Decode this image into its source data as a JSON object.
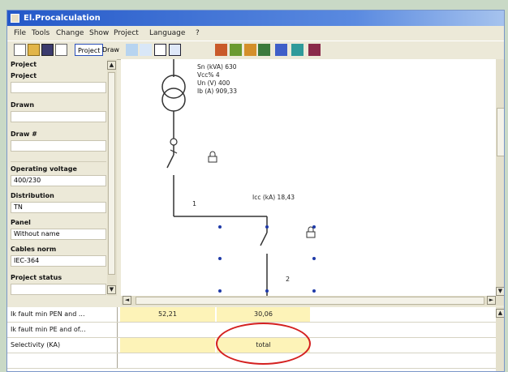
{
  "window": {
    "title": "El.Procalculation"
  },
  "menu": [
    "File",
    "Tools",
    "Change",
    "Show",
    "Project",
    "Language",
    "?"
  ],
  "toolbar": {
    "project_label": "Project",
    "draw_label": "Draw"
  },
  "project_panel": {
    "header": "Project",
    "fields": [
      {
        "label": "Project",
        "value": ""
      },
      {
        "label": "Drawn",
        "value": ""
      },
      {
        "label": "Draw #",
        "value": ""
      },
      {
        "label": "Operating voltage",
        "value": "400/230"
      },
      {
        "label": "Distribution",
        "value": "TN"
      },
      {
        "label": "Panel",
        "value": "Without name"
      },
      {
        "label": "Cables norm",
        "value": "IEC-364"
      },
      {
        "label": "Project status",
        "value": ""
      }
    ]
  },
  "diagram": {
    "transformer_params": [
      "Sn (kVA) 630",
      "Vcc% 4",
      "Un (V) 400",
      "Ib (A) 909,33"
    ],
    "icc_label": "Icc (kA) 18,43",
    "line_numbers": [
      "1",
      "2"
    ]
  },
  "results": {
    "rows": [
      {
        "label": "Ik fault min PEN and ...",
        "cells": [
          "52,21",
          "30,06"
        ]
      },
      {
        "label": "Ik fault min PE and of...",
        "cells": [
          "",
          ""
        ]
      },
      {
        "label": "Selectivity (KA)",
        "cells": [
          "",
          "total"
        ]
      }
    ]
  },
  "colors": {
    "highlight": "#fdf3b8",
    "annotation": "#d4201f",
    "titlebar": "#2458c8",
    "dots": "#1f3aa8"
  }
}
